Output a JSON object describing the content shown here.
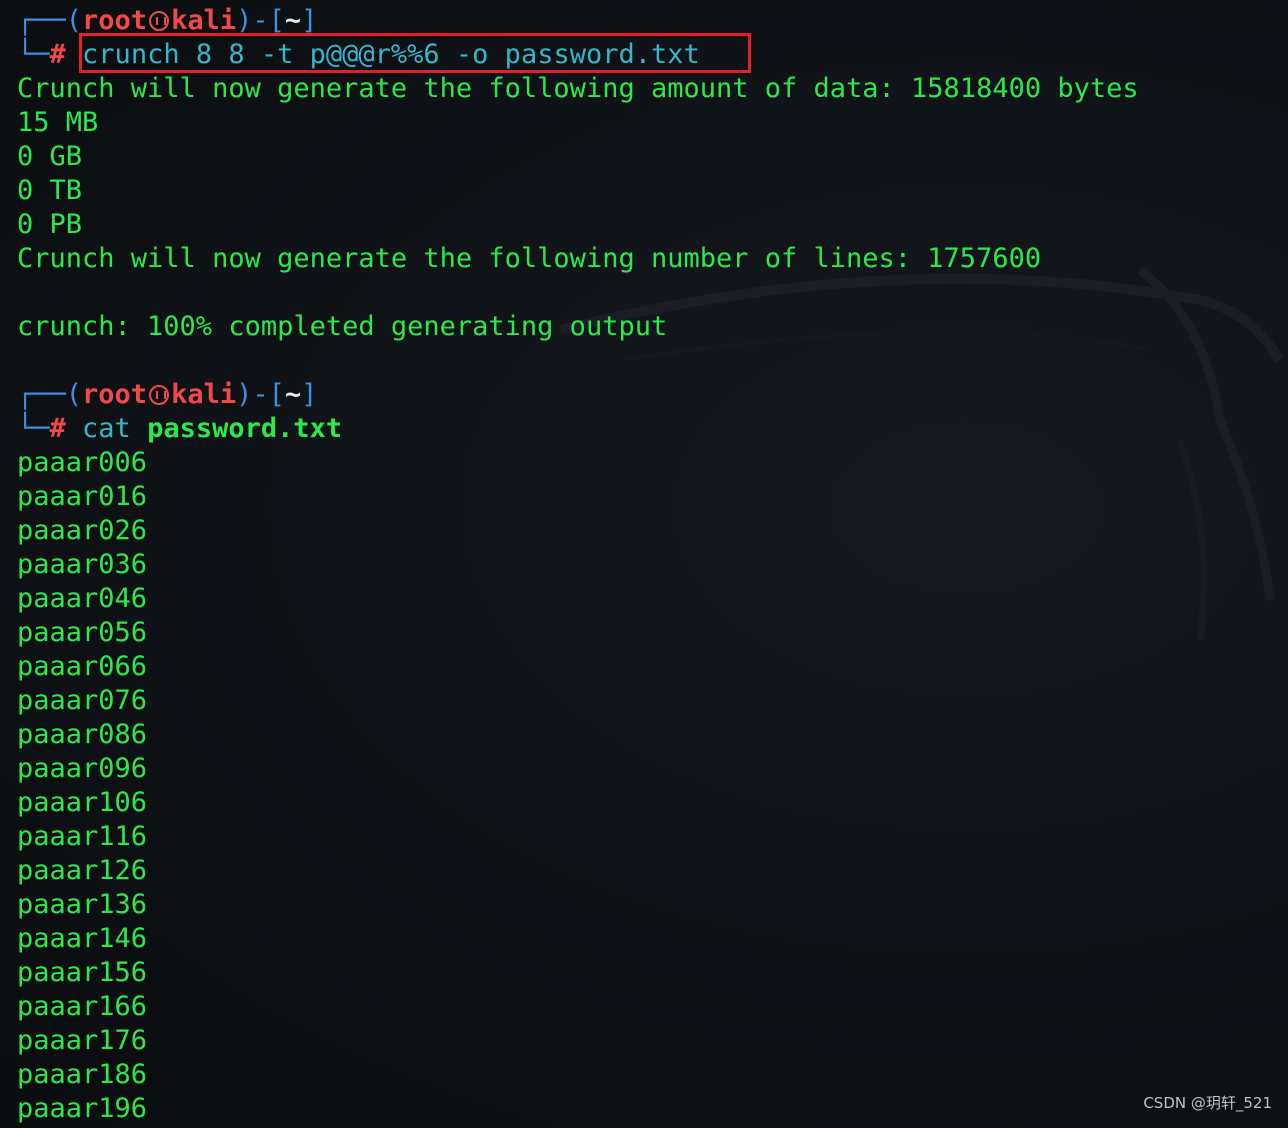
{
  "prompt1": {
    "open": "┌──(",
    "user": "root",
    "host": "kali",
    "close": ")-[",
    "cwd": "~",
    "end": "]",
    "corner": "└─",
    "hash": "#",
    "command": "crunch 8 8 -t p@@@r%%6 -o password.txt"
  },
  "output": [
    "Crunch will now generate the following amount of data: 15818400 bytes",
    "15 MB",
    "0 GB",
    "0 TB",
    "0 PB",
    "Crunch will now generate the following number of lines: 1757600",
    "",
    "crunch: 100% completed generating output",
    ""
  ],
  "prompt2": {
    "open": "┌──(",
    "user": "root",
    "host": "kali",
    "close": ")-[",
    "cwd": "~",
    "end": "]",
    "corner": "└─",
    "hash": "#",
    "command": "cat",
    "argument": "password.txt"
  },
  "passwords": [
    "paaar006",
    "paaar016",
    "paaar026",
    "paaar036",
    "paaar046",
    "paaar056",
    "paaar066",
    "paaar076",
    "paaar086",
    "paaar096",
    "paaar106",
    "paaar116",
    "paaar126",
    "paaar136",
    "paaar146",
    "paaar156",
    "paaar166",
    "paaar176",
    "paaar186",
    "paaar196"
  ],
  "watermark": "CSDN @玥轩_521",
  "colors": {
    "background": "#0d1014",
    "text_green": "#2ce84a",
    "prompt_blue": "#3f8fe0",
    "user_red": "#ef4a4a",
    "command_cyan": "#35b7c9",
    "highlight_red": "#e81d25"
  }
}
